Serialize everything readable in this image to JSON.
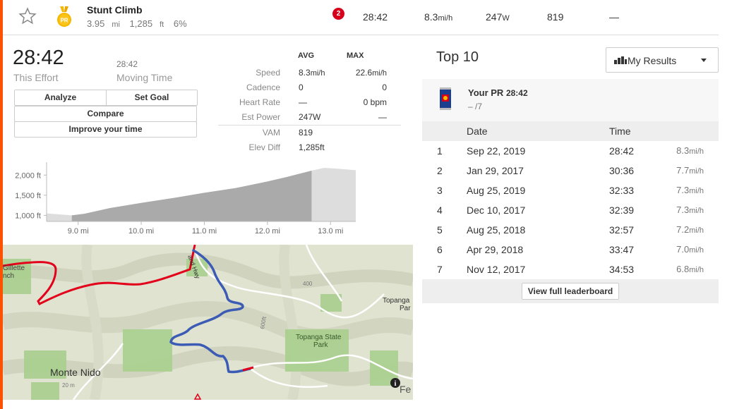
{
  "segment": {
    "name": "Stunt Climb",
    "distance": "3.95",
    "distance_unit": "mi",
    "elevation": "1,285",
    "elevation_unit": "ft",
    "grade": "6%",
    "pr_label": "PR",
    "rank_badge": "2",
    "time": "28:42",
    "speed": "8.3",
    "speed_unit": "mi/h",
    "power": "247",
    "power_unit": "W",
    "vam": "819",
    "hr": "—"
  },
  "effort": {
    "time": "28:42",
    "time_label": "This Effort",
    "moving_time": "28:42",
    "moving_label": "Moving Time",
    "buttons": {
      "analyze": "Analyze",
      "set_goal": "Set Goal",
      "compare": "Compare",
      "improve": "Improve your time"
    }
  },
  "stats": {
    "avg_header": "AVG",
    "max_header": "MAX",
    "rows": [
      {
        "label": "Speed",
        "avg": "8.3",
        "avg_unit": "mi/h",
        "max": "22.6",
        "max_unit": "mi/h"
      },
      {
        "label": "Cadence",
        "avg": "0",
        "avg_unit": "",
        "max": "0",
        "max_unit": ""
      },
      {
        "label": "Heart Rate",
        "avg": "—",
        "avg_unit": "",
        "max": "0 bpm",
        "max_unit": ""
      },
      {
        "label": "Est Power",
        "avg": "247W",
        "avg_unit": "",
        "max": "—",
        "max_unit": ""
      },
      {
        "label": "VAM",
        "avg": "819",
        "avg_unit": "",
        "max": "",
        "max_unit": ""
      },
      {
        "label": "Elev Diff",
        "avg": "1,285ft",
        "avg_unit": "",
        "max": "",
        "max_unit": ""
      }
    ]
  },
  "chart_data": {
    "type": "area",
    "xlabel": "",
    "ylabel": "",
    "x_ticks": [
      "9.0 mi",
      "10.0 mi",
      "11.0 mi",
      "12.0 mi",
      "13.0 mi"
    ],
    "y_ticks": [
      "2,000 ft",
      "1,500 ft",
      "1,000 ft"
    ],
    "xlim": [
      8.5,
      13.4
    ],
    "ylim": [
      850,
      2250
    ],
    "segment_range": [
      8.9,
      12.7
    ],
    "series": [
      {
        "values_x": [
          8.5,
          8.9,
          9.1,
          9.5,
          10.0,
          10.5,
          11.0,
          11.5,
          12.0,
          12.3,
          12.7,
          12.9,
          13.1,
          13.4
        ],
        "values_y": [
          1050,
          1000,
          1040,
          1180,
          1310,
          1430,
          1560,
          1680,
          1840,
          1950,
          2110,
          2180,
          2160,
          2120
        ]
      }
    ],
    "colors": {
      "fill": "#aaaaaa",
      "fill_outside": "#dddddd"
    }
  },
  "map": {
    "labels": [
      "Gillette",
      "nch",
      "Monte Nido",
      "Topanga State",
      "Park",
      "Topanga",
      "Par",
      "Fe",
      "400",
      "600ft",
      "20 m",
      "and Hwy"
    ],
    "route_color": "#3b5bb5",
    "road_color": "#e2001a"
  },
  "leaderboard": {
    "title": "Top 10",
    "filter": "My Results",
    "your_pr_label": "Your PR",
    "your_pr_time": "28:42",
    "your_pr_rank": "– /7",
    "col_date": "Date",
    "col_time": "Time",
    "rows": [
      {
        "rank": "1",
        "date": "Sep 22, 2019",
        "time": "28:42",
        "speed": "8.3",
        "unit": "mi/h"
      },
      {
        "rank": "2",
        "date": "Jan 29, 2017",
        "time": "30:36",
        "speed": "7.7",
        "unit": "mi/h"
      },
      {
        "rank": "3",
        "date": "Aug 25, 2019",
        "time": "32:33",
        "speed": "7.3",
        "unit": "mi/h"
      },
      {
        "rank": "4",
        "date": "Dec 10, 2017",
        "time": "32:39",
        "speed": "7.3",
        "unit": "mi/h"
      },
      {
        "rank": "5",
        "date": "Aug 25, 2018",
        "time": "32:57",
        "speed": "7.2",
        "unit": "mi/h"
      },
      {
        "rank": "6",
        "date": "Apr 29, 2018",
        "time": "33:47",
        "speed": "7.0",
        "unit": "mi/h"
      },
      {
        "rank": "7",
        "date": "Nov 12, 2017",
        "time": "34:53",
        "speed": "6.8",
        "unit": "mi/h"
      }
    ],
    "view_full": "View full leaderboard"
  },
  "colors": {
    "accent": "#fc5200",
    "badge": "#d6001c",
    "medal": "#f5b800"
  }
}
